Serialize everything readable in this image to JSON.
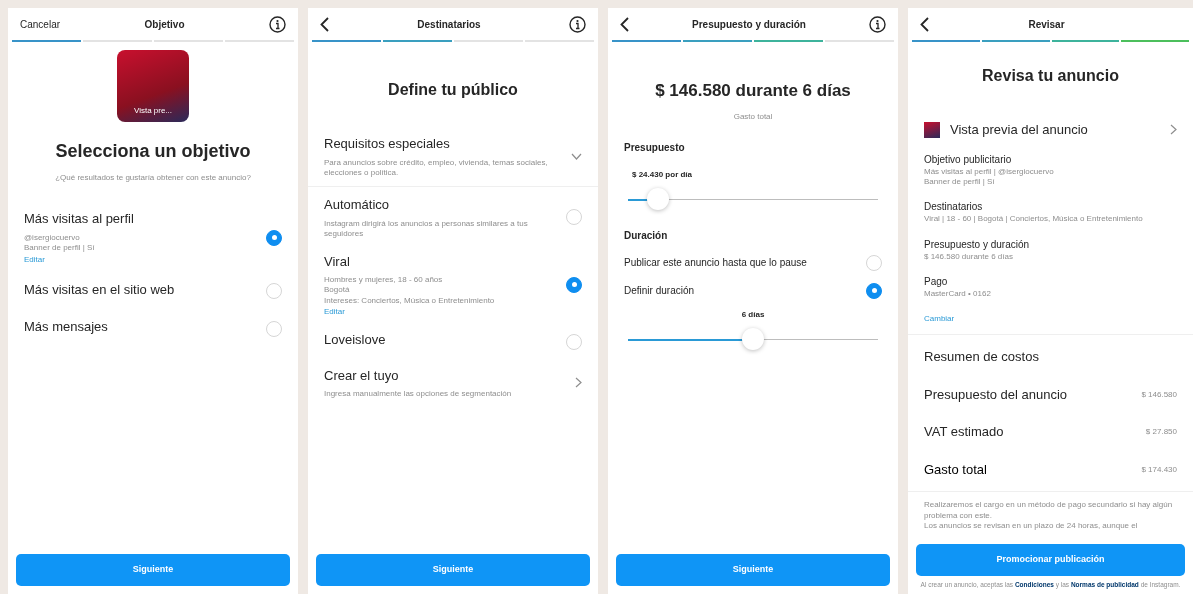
{
  "objective_screen": {
    "cancel_label": "Cancelar",
    "title": "Objetivo",
    "progress": [
      {
        "filled": true
      },
      {
        "filled": false
      },
      {
        "filled": false
      },
      {
        "filled": false
      }
    ],
    "preview_caption": "Vista pre...",
    "heading": "Selecciona un objetivo",
    "subtitle": "¿Qué resultados te gustaría obtener con este anuncio?",
    "options": [
      {
        "label": "Más visitas al perfil",
        "details": [
          "@isergiocuervo",
          "Banner de perfil | Sí"
        ],
        "link": "Editar",
        "selected": true
      },
      {
        "label": "Más visitas en el sitio web",
        "selected": false
      },
      {
        "label": "Más mensajes",
        "selected": false
      }
    ],
    "button": "Siguiente"
  },
  "audience_screen": {
    "title": "Destinatarios",
    "progress": [
      {
        "filled": true
      },
      {
        "filled": true
      },
      {
        "filled": false
      },
      {
        "filled": false
      }
    ],
    "heading": "Define tu público",
    "special": {
      "label": "Requisitos especiales",
      "description": "Para anuncios sobre crédito, empleo, vivienda, temas sociales, elecciones o política."
    },
    "options": [
      {
        "kind": "radio",
        "label": "Automático",
        "details": [
          "Instagram dirigirá los anuncios a personas similares a tus seguidores"
        ],
        "selected": false
      },
      {
        "kind": "radio",
        "label": "Viral",
        "details": [
          "Hombres y mujeres, 18 - 60 años",
          "Bogotá",
          "Intereses: Conciertos, Música o Entretenimiento"
        ],
        "link": "Editar",
        "selected": true
      },
      {
        "kind": "radio",
        "label": "Loveislove",
        "selected": false
      },
      {
        "kind": "link",
        "label": "Crear el tuyo",
        "details": [
          "Ingresa manualmente las opciones de segmentación"
        ]
      }
    ],
    "button": "Siguiente"
  },
  "budget_screen": {
    "title": "Presupuesto y duración",
    "progress": [
      {
        "filled": true
      },
      {
        "filled": true
      },
      {
        "filled": true
      },
      {
        "filled": false
      }
    ],
    "heading": "$ 146.580 durante 6 días",
    "subheading": "Gasto total",
    "budget": {
      "label": "Presupuesto",
      "reading": "$ 24.430 por día",
      "level": 0.12
    },
    "duration": {
      "label": "Duración",
      "options": [
        {
          "label": "Publicar este anuncio hasta que lo pause",
          "selected": false
        },
        {
          "label": "Definir duración",
          "selected": true
        }
      ],
      "reading": "6 días",
      "level": 0.5
    },
    "button": "Siguiente"
  },
  "review_screen": {
    "title": "Revisar",
    "progress": [
      {
        "filled": true
      },
      {
        "filled": true
      },
      {
        "filled": true
      },
      {
        "filled": true
      }
    ],
    "heading": "Revisa tu anuncio",
    "preview_label": "Vista previa del anuncio",
    "summary": [
      {
        "title": "Objetivo publicitario",
        "lines": [
          "Más visitas al perfil | @isergiocuervo",
          "Banner de perfil | Sí"
        ]
      },
      {
        "title": "Destinatarios",
        "lines": [
          "Viral | 18 - 60 | Bogotá | Conciertos, Música o Entretenimiento"
        ]
      },
      {
        "title": "Presupuesto y duración",
        "lines": [
          "$ 146.580 durante 6 días"
        ]
      },
      {
        "title": "Pago",
        "lines": [
          "MasterCard • 0162"
        ]
      }
    ],
    "change_link": "Cambiar",
    "costs_title": "Resumen de costos",
    "costs": [
      {
        "kind": "normal",
        "label": "Presupuesto del anuncio",
        "amount": "$ 146.580"
      },
      {
        "kind": "normal",
        "label": "VAT estimado",
        "amount": "$ 27.850"
      },
      {
        "kind": "total",
        "label": "Gasto total",
        "amount": "$ 174.430"
      }
    ],
    "disclaimer": [
      "Realizaremos el cargo en un método de pago secundario si hay algún problema con este.",
      "Los anuncios se revisan en un plazo de 24 horas, aunque el"
    ],
    "button": "Promocionar publicación",
    "terms": [
      {
        "kind": "text",
        "text": "Al crear un anuncio, aceptas las "
      },
      {
        "kind": "link",
        "text": "Condiciones"
      },
      {
        "kind": "text",
        "text": " y las "
      },
      {
        "kind": "link",
        "text": "Normas de publicidad"
      },
      {
        "kind": "text",
        "text": " de Instagram."
      }
    ]
  }
}
